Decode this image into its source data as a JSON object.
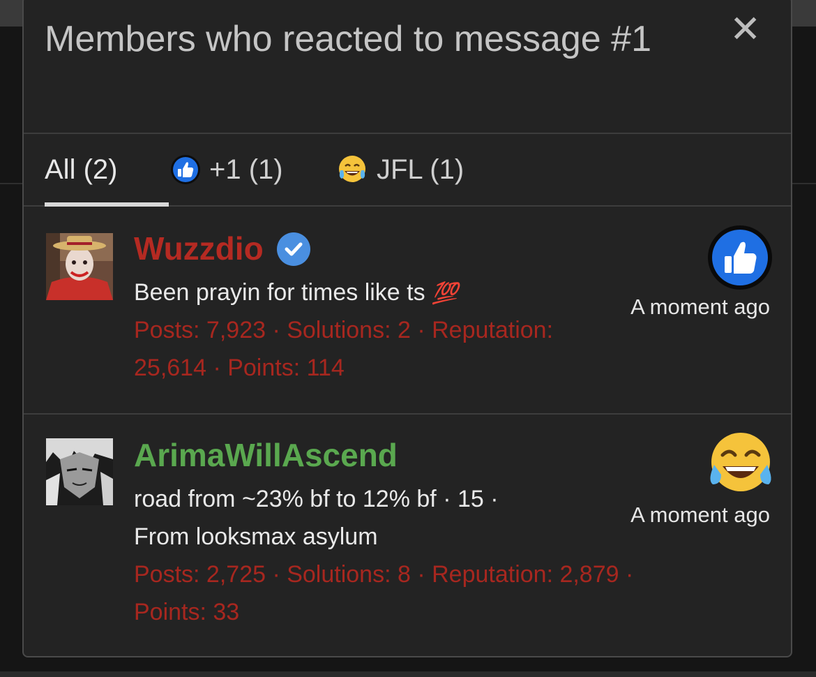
{
  "dialog": {
    "title": "Members who reacted to message #1",
    "close_glyph": "✕"
  },
  "tabs": [
    {
      "label": "All (2)",
      "icon": null,
      "active": true
    },
    {
      "label": "+1 (1)",
      "icon": "like-icon",
      "active": false
    },
    {
      "label": "JFL (1)",
      "icon": "joy-crying-icon",
      "active": false
    }
  ],
  "members": [
    {
      "username": "Wuzzdio",
      "username_color": "#b52a22",
      "verified": true,
      "message": "Been prayin for times like ts",
      "message_emoji": "💯",
      "stats_line1": "Posts: 7,923 · Solutions: 2 · Reputation:",
      "stats_line2": "25,614 · Points: 114",
      "time": "A moment ago",
      "reaction": "like-icon"
    },
    {
      "username": "ArimaWillAscend",
      "username_color": "#5aa84f",
      "verified": false,
      "message_line1": "road from ~23% bf to 12% bf · 15 ·",
      "message_line2": "From looksmax asylum",
      "stats_line1": "Posts: 2,725 · Solutions: 8 · Reputation: 2,879 ·",
      "stats_line2": "Points: 33",
      "time": "A moment ago",
      "reaction": "joy-crying-icon"
    }
  ],
  "colors": {
    "background": "#232323",
    "stats_red": "#a7271f",
    "like_blue": "#1f6fe3",
    "verified_blue": "#4a8fe0",
    "emoji_yellow": "#f5c33b"
  }
}
